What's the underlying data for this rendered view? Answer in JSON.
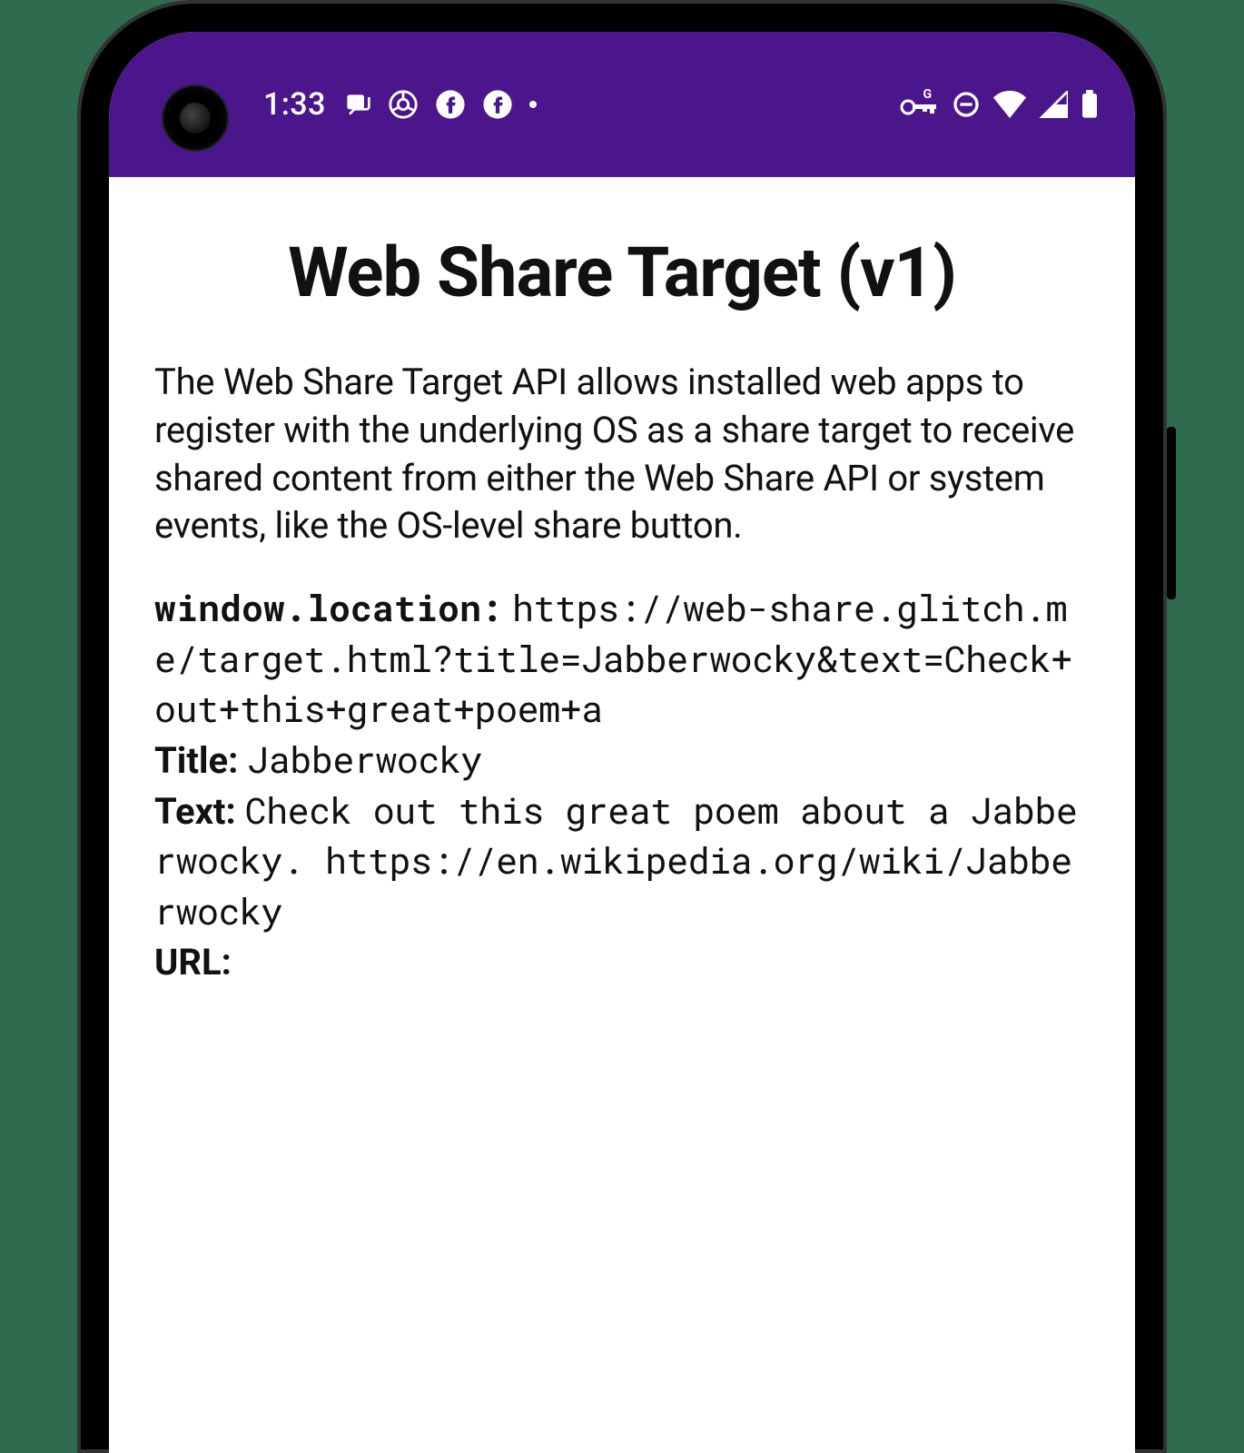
{
  "status_bar": {
    "time": "1:33",
    "key_badge": "G"
  },
  "page": {
    "title": "Web Share Target (v1)",
    "description": "The Web Share Target API allows installed web apps to register with the underlying OS as a share target to receive shared content from either the Web Share API or system events, like the OS-level share button."
  },
  "details": {
    "location_label": "window.location:",
    "location_value": "https://web-share.glitch.me/target.html?title=Jabberwocky&text=Check+out+this+great+poem+a",
    "title_label": "Title:",
    "title_value": "Jabberwocky",
    "text_label": "Text:",
    "text_value": "Check out this great poem about a Jabberwocky. https://en.wikipedia.org/wiki/Jabberwocky",
    "url_label": "URL:",
    "url_value": ""
  }
}
